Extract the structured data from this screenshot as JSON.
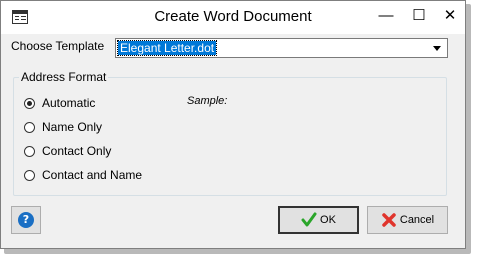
{
  "window": {
    "title": "Create Word Document",
    "minimize_glyph": "—",
    "maximize_glyph": "☐",
    "close_glyph": "✕"
  },
  "template": {
    "label": "Choose Template",
    "selected": "Elegant Letter.dot"
  },
  "address_format": {
    "legend": "Address Format",
    "options": [
      "Automatic",
      "Name Only",
      "Contact Only",
      "Contact and Name"
    ],
    "selected_index": 0,
    "sample_label": "Sample:"
  },
  "buttons": {
    "help_glyph": "?",
    "ok": "OK",
    "cancel": "Cancel"
  },
  "colors": {
    "selection": "#0078d7",
    "ok_check": "#2aa52a",
    "cancel_x": "#e0342c",
    "help_blue": "#1a6fc4"
  }
}
